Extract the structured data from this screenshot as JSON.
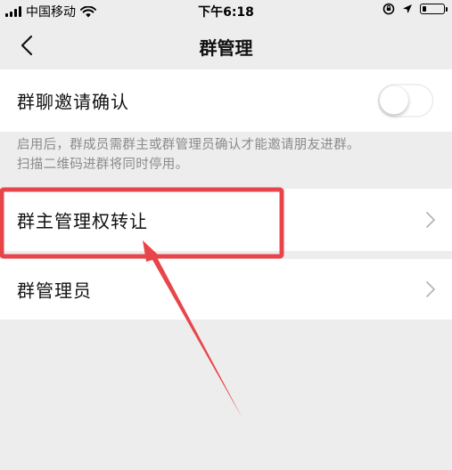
{
  "status_bar": {
    "carrier": "中国移动",
    "time": "下午6:18",
    "battery_level": 0.2
  },
  "nav": {
    "title": "群管理",
    "back_icon": "chevron-left-icon"
  },
  "settings": {
    "invite_confirm": {
      "label": "群聊邀请确认",
      "enabled": false
    },
    "hint_lines": [
      "启用后，群成员需群主或群管理员确认才能邀请朋友进群。",
      "扫描二维码进群将同时停用。"
    ],
    "transfer_owner": {
      "label": "群主管理权转让"
    },
    "admins": {
      "label": "群管理员"
    }
  },
  "annotation": {
    "color": "#e8454b"
  }
}
